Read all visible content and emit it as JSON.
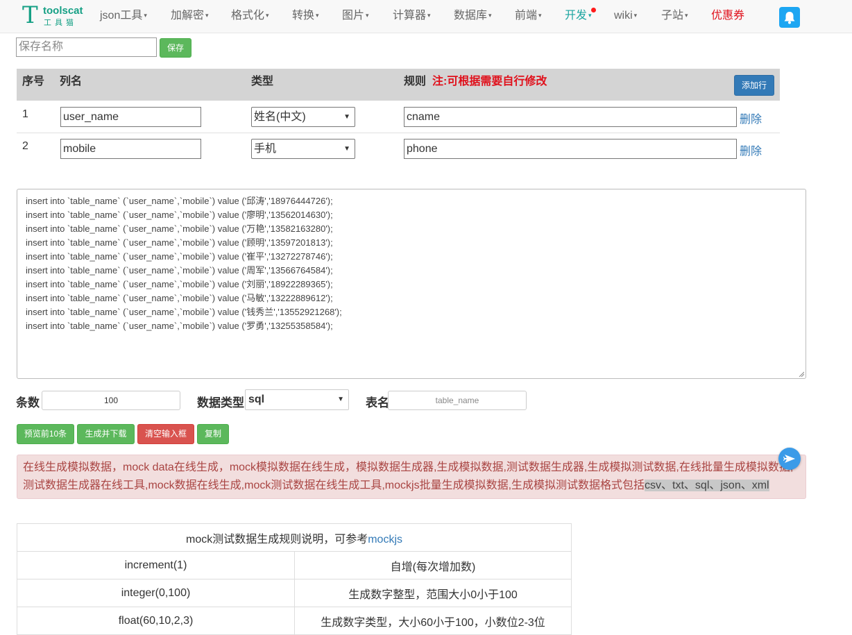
{
  "logo": {
    "letter": "T",
    "name": "toolscat",
    "subtitle": "工具猫"
  },
  "nav": {
    "items": [
      {
        "label": "json工具",
        "caret": "▾"
      },
      {
        "label": "加解密",
        "caret": "▾"
      },
      {
        "label": "格式化",
        "caret": "▾"
      },
      {
        "label": "转换",
        "caret": "▾"
      },
      {
        "label": "图片",
        "caret": "▾"
      },
      {
        "label": "计算器",
        "caret": "▾"
      },
      {
        "label": "数据库",
        "caret": "▾"
      },
      {
        "label": "前端",
        "caret": "▾"
      },
      {
        "label": "开发",
        "caret": "▾"
      },
      {
        "label": "wiki",
        "caret": "▾"
      },
      {
        "label": "子站",
        "caret": "▾"
      },
      {
        "label": "优惠券"
      }
    ],
    "notify_icon": "bell-icon"
  },
  "save": {
    "placeholder": "保存名称",
    "button": "保存"
  },
  "columns_table": {
    "headers": {
      "index": "序号",
      "name": "列名",
      "type": "类型",
      "rule": "规则",
      "note": "注:可根据需要自行修改"
    },
    "add_button": "添加行",
    "rows": [
      {
        "index": "1",
        "name": "user_name",
        "type": "姓名(中文)",
        "rule": "cname",
        "delete": "删除"
      },
      {
        "index": "2",
        "name": "mobile",
        "type": "手机",
        "rule": "phone",
        "delete": "删除"
      }
    ]
  },
  "output": {
    "lines": [
      "insert into `table_name` (`user_name`,`mobile`) value ('邱涛','18976444726');",
      "insert into `table_name` (`user_name`,`mobile`) value ('廖明','13562014630');",
      "insert into `table_name` (`user_name`,`mobile`) value ('万艳','13582163280');",
      "insert into `table_name` (`user_name`,`mobile`) value ('顾明','13597201813');",
      "insert into `table_name` (`user_name`,`mobile`) value ('崔平','13272278746');",
      "insert into `table_name` (`user_name`,`mobile`) value ('周军','13566764584');",
      "insert into `table_name` (`user_name`,`mobile`) value ('刘丽','18922289365');",
      "insert into `table_name` (`user_name`,`mobile`) value ('马敏','13222889612');",
      "insert into `table_name` (`user_name`,`mobile`) value ('钱秀兰','13552921268');",
      "insert into `table_name` (`user_name`,`mobile`) value ('罗勇','13255358584');"
    ]
  },
  "options": {
    "count_label": "条数",
    "count_value": "100",
    "datatype_label": "数据类型",
    "datatype_value": "sql",
    "table_label": "表名",
    "table_placeholder": "table_name"
  },
  "actions": {
    "preview": "预览前10条",
    "generate": "生成并下载",
    "clear": "清空输入框",
    "copy": "复制"
  },
  "description": {
    "text": "在线生成模拟数据，mock data在线生成，mock模拟数据在线生成，模拟数据生成器,生成模拟数据,测试数据生成器,生成模拟测试数据,在线批量生成模拟数据,测试数据生成器在线工具,mock数据在线生成,mock测试数据在线生成工具,mockjs批量生成模拟数据,生成模拟测试数据格式包括",
    "highlight": "csv、txt、sql、json、xml"
  },
  "rules_table": {
    "caption": "mock测试数据生成规则说明，可参考",
    "caption_link": "mockjs",
    "rows": [
      {
        "rule": "increment(1)",
        "desc": "自增(每次增加数)"
      },
      {
        "rule": "integer(0,100)",
        "desc": "生成数字整型，范围大小0小于100"
      },
      {
        "rule": "float(60,10,2,3)",
        "desc": "生成数字类型，大小60小于100，小数位2-3位"
      }
    ]
  },
  "colors": {
    "brand": "#16a085",
    "nav_active": "#1ba5a0",
    "promo": "#e0101b",
    "success": "#5cb85c",
    "danger": "#d9534f",
    "primary": "#337ab7"
  }
}
